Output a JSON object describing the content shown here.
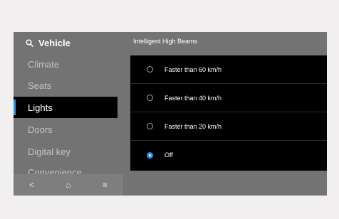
{
  "sidebar": {
    "header_label": "Vehicle",
    "items": [
      {
        "label": "Climate"
      },
      {
        "label": "Seats"
      },
      {
        "label": "Lights"
      },
      {
        "label": "Doors"
      },
      {
        "label": "Digital key"
      },
      {
        "label": "Convenience"
      }
    ],
    "selected_index": 2
  },
  "bottom_nav": {
    "back_glyph": "<",
    "home_glyph": "⌂",
    "menu_glyph": "≡"
  },
  "main": {
    "section_title": "Intelligent High Beams",
    "options": [
      {
        "label": "Faster than 60 km/h",
        "selected": false
      },
      {
        "label": "Faster than 40 km/h",
        "selected": false
      },
      {
        "label": "Faster than 20 km/h",
        "selected": false
      },
      {
        "label": "Off",
        "selected": true
      }
    ]
  },
  "colors": {
    "accent": "#2196f3",
    "panel_bg": "#737373",
    "page_bg": "#f1efef"
  }
}
